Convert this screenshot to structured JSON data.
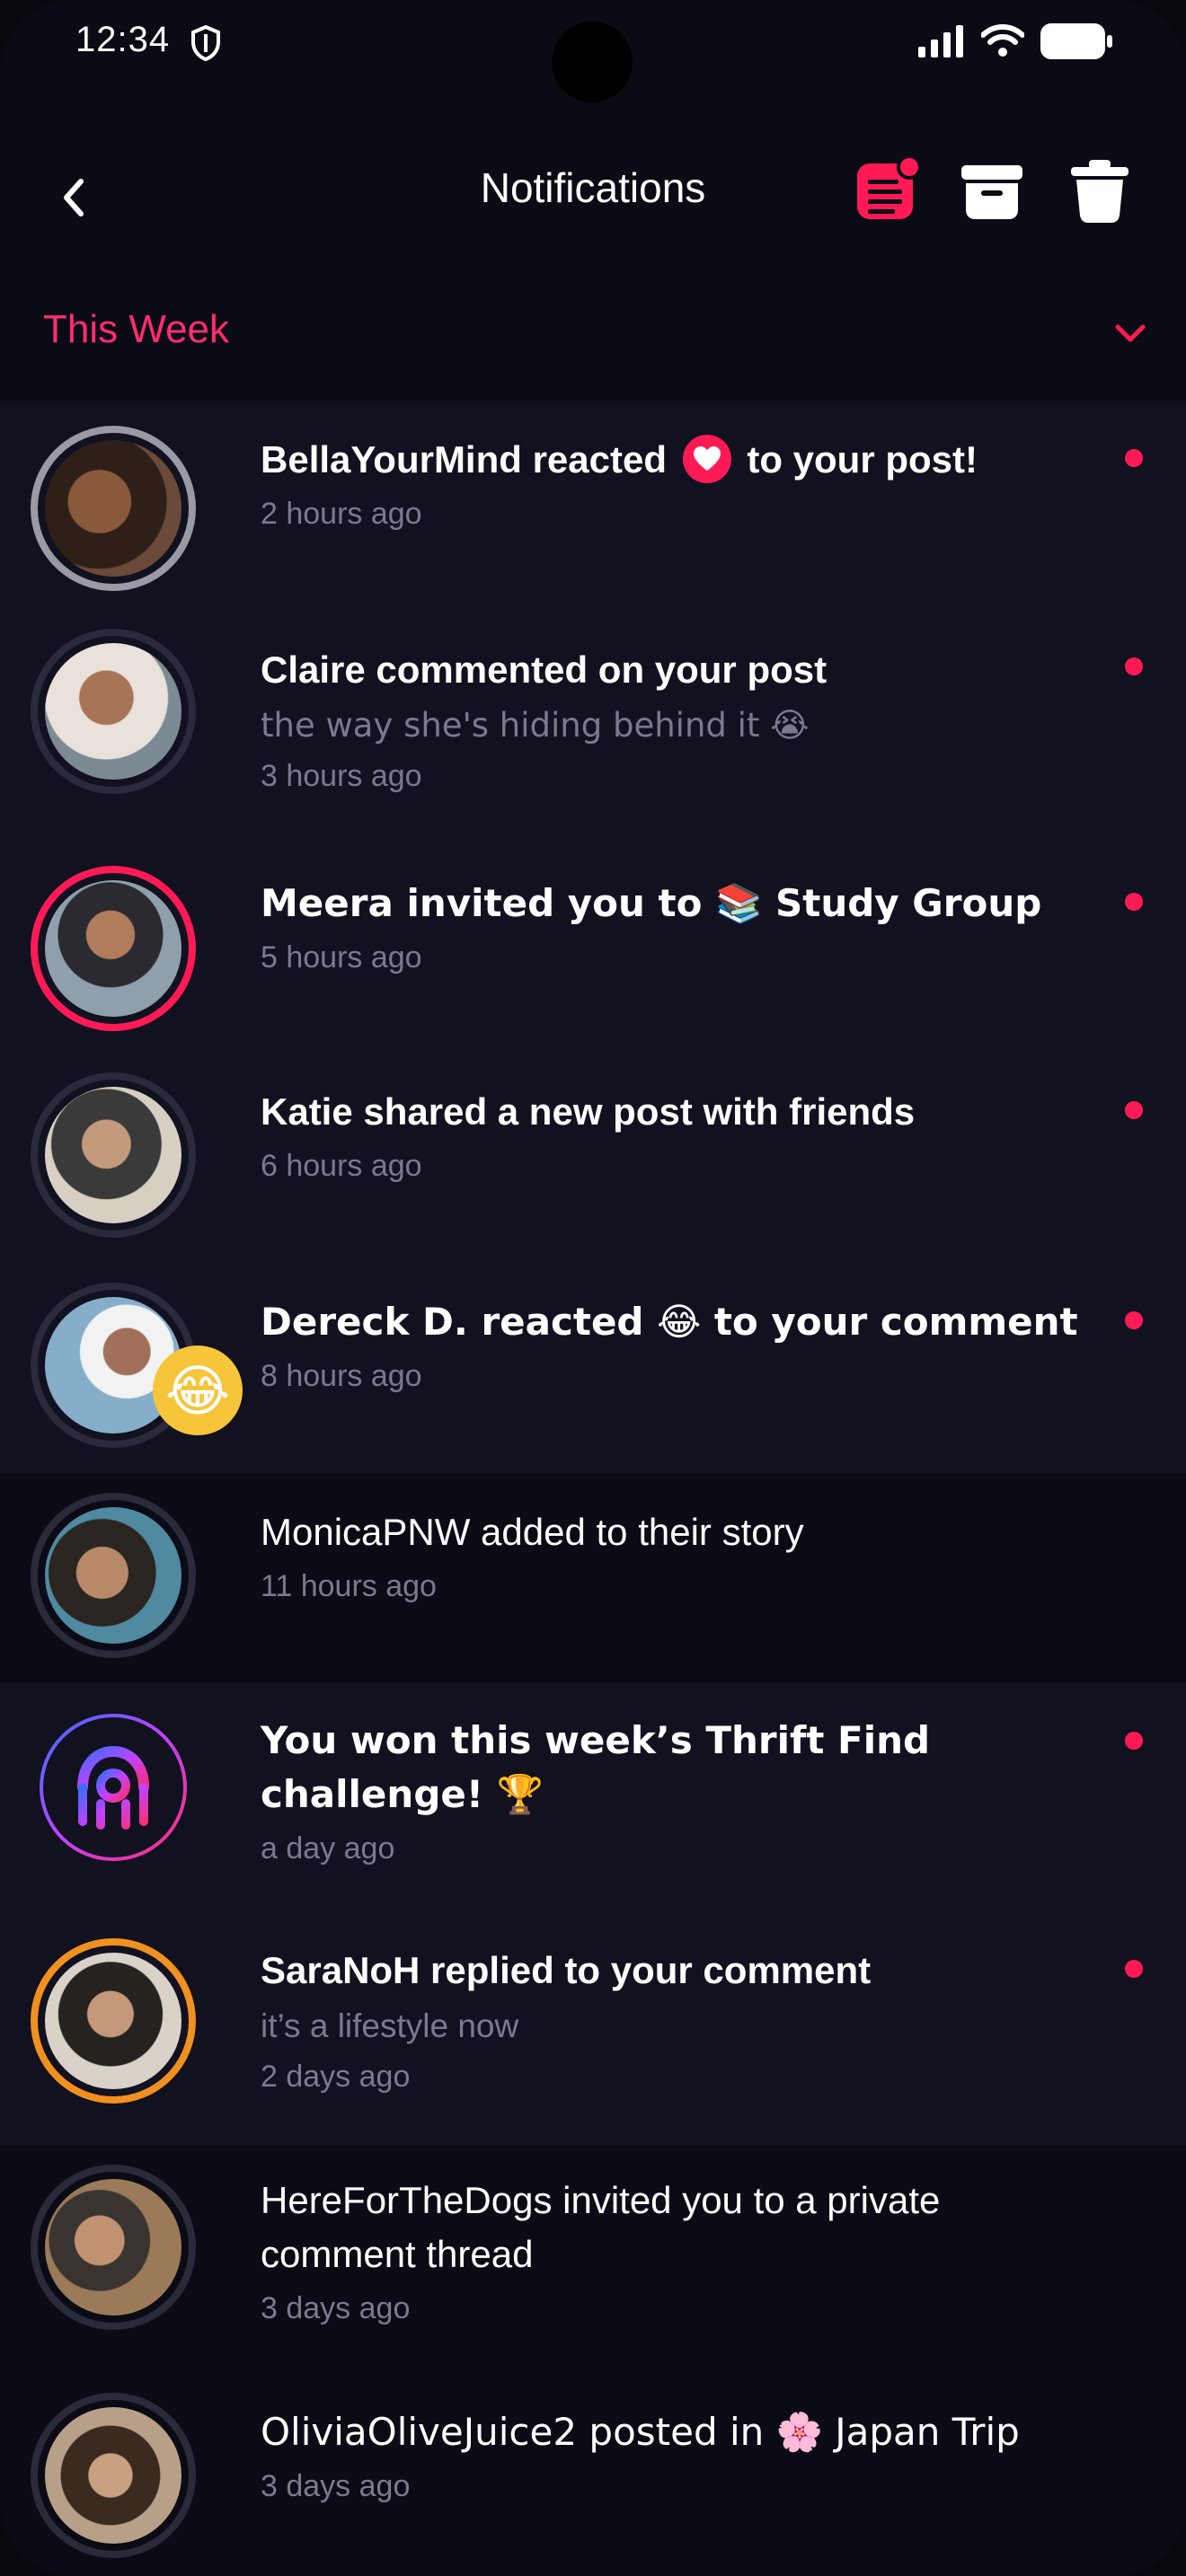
{
  "status_bar": {
    "time": "12:34"
  },
  "header": {
    "title": "Notifications"
  },
  "section": {
    "label": "This Week"
  },
  "colors": {
    "accent": "#ff1a55",
    "background": "#0b0b16",
    "unread_row": "#111120"
  },
  "notifications": [
    {
      "main_prefix": "BellaYourMind reacted",
      "main_suffix": "to your post!",
      "time": "2 hours ago",
      "unread": true
    },
    {
      "main": "Claire commented on your post",
      "sub": "the way she's hiding behind it 😭",
      "time": "3 hours ago",
      "unread": true
    },
    {
      "main": "Meera invited you to 📚 Study Group",
      "time": "5 hours ago",
      "unread": true
    },
    {
      "main": "Katie shared a new post with friends",
      "time": "6 hours ago",
      "unread": true
    },
    {
      "main": "Dereck D. reacted 😂 to your comment",
      "time": "8 hours ago",
      "unread": true,
      "badge": "😂"
    },
    {
      "main": "MonicaPNW added to their story",
      "time": "11 hours ago",
      "unread": false
    },
    {
      "main": "You won this week’s Thrift Find challenge! 🏆",
      "time": "a day ago",
      "unread": true
    },
    {
      "main": "SaraNoH replied to your comment",
      "sub": "it’s a lifestyle now",
      "time": "2 days ago",
      "unread": true
    },
    {
      "main": "HereForTheDogs invited you to a private comment thread",
      "time": "3 days ago",
      "unread": false
    },
    {
      "main": "OliviaOliveJuice2 posted in 🌸 Japan Trip",
      "time": "3 days ago",
      "unread": false
    }
  ]
}
